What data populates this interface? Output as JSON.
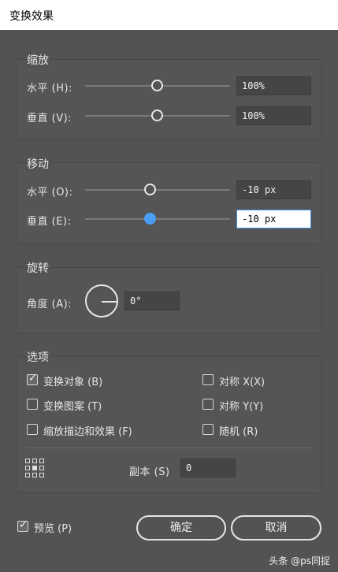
{
  "window": {
    "title": "变换效果"
  },
  "scale": {
    "legend": "缩放",
    "horizontal": {
      "label": "水平 (H):",
      "value": "100%",
      "slider": 0.5
    },
    "vertical": {
      "label": "垂直 (V):",
      "value": "100%",
      "slider": 0.5
    }
  },
  "move": {
    "legend": "移动",
    "horizontal": {
      "label": "水平 (O):",
      "value": "-10 px",
      "slider": 0.45
    },
    "vertical": {
      "label": "垂直 (E):",
      "value": "-10 px",
      "slider": 0.45
    }
  },
  "rotate": {
    "legend": "旋转",
    "angle": {
      "label": "角度 (A):",
      "value": "0°"
    }
  },
  "options": {
    "legend": "选项",
    "transform_objects": {
      "label": "变换对象 (B)",
      "checked": true
    },
    "transform_patterns": {
      "label": "变换图案 (T)",
      "checked": false
    },
    "scale_strokes": {
      "label": "缩放描边和效果 (F)",
      "checked": false
    },
    "reflect_x": {
      "label": "对称 X(X)",
      "checked": false
    },
    "reflect_y": {
      "label": "对称 Y(Y)",
      "checked": false
    },
    "random": {
      "label": "随机 (R)",
      "checked": false
    },
    "copies": {
      "label": "副本 (S)",
      "value": "0"
    }
  },
  "footer": {
    "preview": {
      "label": "预览 (P)",
      "checked": true
    },
    "ok_label": "确定",
    "cancel_label": "取消"
  },
  "watermark": "头条 @ps同捉"
}
